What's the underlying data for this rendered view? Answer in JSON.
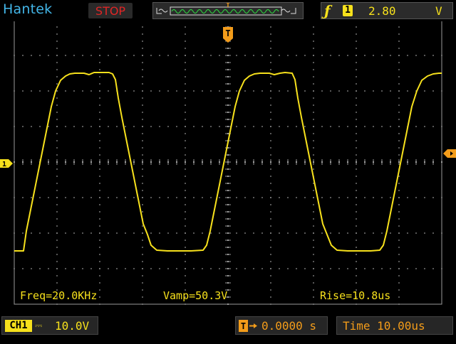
{
  "header": {
    "brand": "Hantek",
    "run_state": "STOP",
    "trigger": {
      "slope_icon": "rising-edge-icon",
      "source": "1",
      "level": "2.80",
      "unit": "V"
    }
  },
  "measurements": {
    "freq": "Freq=20.0KHz",
    "vamp": "Vamp=50.3V",
    "rise": "Rise=10.8us"
  },
  "markers": {
    "channel_marker": "1",
    "trigger_marker": "T"
  },
  "footer": {
    "channel": {
      "label": "CH1",
      "coupling": "⎓",
      "scale": "10.0V"
    },
    "horizontal_position": "0.0000 s",
    "timebase": "Time 10.00us"
  },
  "colors": {
    "trace": "#f7e11c",
    "grid": "#9a9a9a",
    "brand": "#43b6e8",
    "stop": "#e02525",
    "trigger": "#f39c1a"
  }
}
